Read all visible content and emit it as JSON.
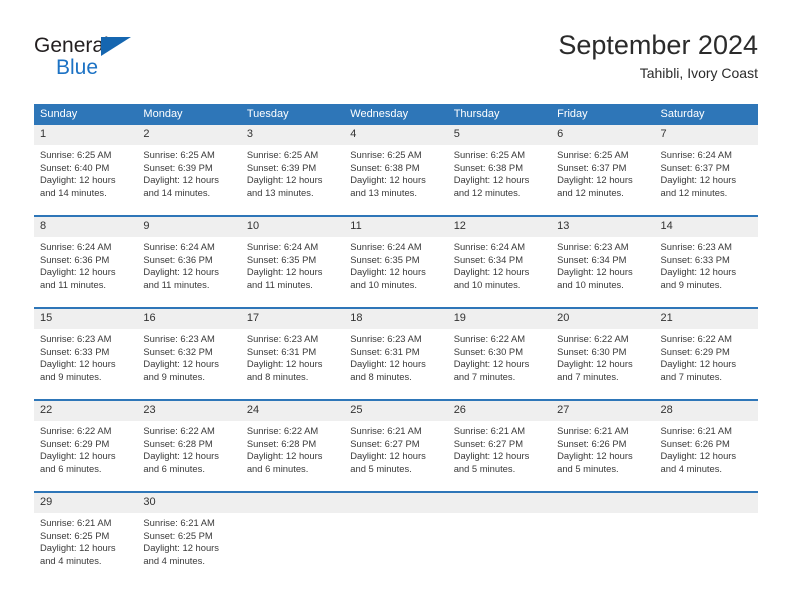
{
  "logo": {
    "word1": "General",
    "word2": "Blue",
    "triangle_color": "#1566b0",
    "word2_color": "#1c72c4"
  },
  "header": {
    "title": "September 2024",
    "subtitle": "Tahibli, Ivory Coast"
  },
  "calendar": {
    "header_bg": "#2e76b8",
    "daynum_bg": "#efefef",
    "weekdays": [
      "Sunday",
      "Monday",
      "Tuesday",
      "Wednesday",
      "Thursday",
      "Friday",
      "Saturday"
    ],
    "weeks": [
      [
        {
          "day": "1",
          "sunrise": "Sunrise: 6:25 AM",
          "sunset": "Sunset: 6:40 PM",
          "daylight1": "Daylight: 12 hours",
          "daylight2": "and 14 minutes."
        },
        {
          "day": "2",
          "sunrise": "Sunrise: 6:25 AM",
          "sunset": "Sunset: 6:39 PM",
          "daylight1": "Daylight: 12 hours",
          "daylight2": "and 14 minutes."
        },
        {
          "day": "3",
          "sunrise": "Sunrise: 6:25 AM",
          "sunset": "Sunset: 6:39 PM",
          "daylight1": "Daylight: 12 hours",
          "daylight2": "and 13 minutes."
        },
        {
          "day": "4",
          "sunrise": "Sunrise: 6:25 AM",
          "sunset": "Sunset: 6:38 PM",
          "daylight1": "Daylight: 12 hours",
          "daylight2": "and 13 minutes."
        },
        {
          "day": "5",
          "sunrise": "Sunrise: 6:25 AM",
          "sunset": "Sunset: 6:38 PM",
          "daylight1": "Daylight: 12 hours",
          "daylight2": "and 12 minutes."
        },
        {
          "day": "6",
          "sunrise": "Sunrise: 6:25 AM",
          "sunset": "Sunset: 6:37 PM",
          "daylight1": "Daylight: 12 hours",
          "daylight2": "and 12 minutes."
        },
        {
          "day": "7",
          "sunrise": "Sunrise: 6:24 AM",
          "sunset": "Sunset: 6:37 PM",
          "daylight1": "Daylight: 12 hours",
          "daylight2": "and 12 minutes."
        }
      ],
      [
        {
          "day": "8",
          "sunrise": "Sunrise: 6:24 AM",
          "sunset": "Sunset: 6:36 PM",
          "daylight1": "Daylight: 12 hours",
          "daylight2": "and 11 minutes."
        },
        {
          "day": "9",
          "sunrise": "Sunrise: 6:24 AM",
          "sunset": "Sunset: 6:36 PM",
          "daylight1": "Daylight: 12 hours",
          "daylight2": "and 11 minutes."
        },
        {
          "day": "10",
          "sunrise": "Sunrise: 6:24 AM",
          "sunset": "Sunset: 6:35 PM",
          "daylight1": "Daylight: 12 hours",
          "daylight2": "and 11 minutes."
        },
        {
          "day": "11",
          "sunrise": "Sunrise: 6:24 AM",
          "sunset": "Sunset: 6:35 PM",
          "daylight1": "Daylight: 12 hours",
          "daylight2": "and 10 minutes."
        },
        {
          "day": "12",
          "sunrise": "Sunrise: 6:24 AM",
          "sunset": "Sunset: 6:34 PM",
          "daylight1": "Daylight: 12 hours",
          "daylight2": "and 10 minutes."
        },
        {
          "day": "13",
          "sunrise": "Sunrise: 6:23 AM",
          "sunset": "Sunset: 6:34 PM",
          "daylight1": "Daylight: 12 hours",
          "daylight2": "and 10 minutes."
        },
        {
          "day": "14",
          "sunrise": "Sunrise: 6:23 AM",
          "sunset": "Sunset: 6:33 PM",
          "daylight1": "Daylight: 12 hours",
          "daylight2": "and 9 minutes."
        }
      ],
      [
        {
          "day": "15",
          "sunrise": "Sunrise: 6:23 AM",
          "sunset": "Sunset: 6:33 PM",
          "daylight1": "Daylight: 12 hours",
          "daylight2": "and 9 minutes."
        },
        {
          "day": "16",
          "sunrise": "Sunrise: 6:23 AM",
          "sunset": "Sunset: 6:32 PM",
          "daylight1": "Daylight: 12 hours",
          "daylight2": "and 9 minutes."
        },
        {
          "day": "17",
          "sunrise": "Sunrise: 6:23 AM",
          "sunset": "Sunset: 6:31 PM",
          "daylight1": "Daylight: 12 hours",
          "daylight2": "and 8 minutes."
        },
        {
          "day": "18",
          "sunrise": "Sunrise: 6:23 AM",
          "sunset": "Sunset: 6:31 PM",
          "daylight1": "Daylight: 12 hours",
          "daylight2": "and 8 minutes."
        },
        {
          "day": "19",
          "sunrise": "Sunrise: 6:22 AM",
          "sunset": "Sunset: 6:30 PM",
          "daylight1": "Daylight: 12 hours",
          "daylight2": "and 7 minutes."
        },
        {
          "day": "20",
          "sunrise": "Sunrise: 6:22 AM",
          "sunset": "Sunset: 6:30 PM",
          "daylight1": "Daylight: 12 hours",
          "daylight2": "and 7 minutes."
        },
        {
          "day": "21",
          "sunrise": "Sunrise: 6:22 AM",
          "sunset": "Sunset: 6:29 PM",
          "daylight1": "Daylight: 12 hours",
          "daylight2": "and 7 minutes."
        }
      ],
      [
        {
          "day": "22",
          "sunrise": "Sunrise: 6:22 AM",
          "sunset": "Sunset: 6:29 PM",
          "daylight1": "Daylight: 12 hours",
          "daylight2": "and 6 minutes."
        },
        {
          "day": "23",
          "sunrise": "Sunrise: 6:22 AM",
          "sunset": "Sunset: 6:28 PM",
          "daylight1": "Daylight: 12 hours",
          "daylight2": "and 6 minutes."
        },
        {
          "day": "24",
          "sunrise": "Sunrise: 6:22 AM",
          "sunset": "Sunset: 6:28 PM",
          "daylight1": "Daylight: 12 hours",
          "daylight2": "and 6 minutes."
        },
        {
          "day": "25",
          "sunrise": "Sunrise: 6:21 AM",
          "sunset": "Sunset: 6:27 PM",
          "daylight1": "Daylight: 12 hours",
          "daylight2": "and 5 minutes."
        },
        {
          "day": "26",
          "sunrise": "Sunrise: 6:21 AM",
          "sunset": "Sunset: 6:27 PM",
          "daylight1": "Daylight: 12 hours",
          "daylight2": "and 5 minutes."
        },
        {
          "day": "27",
          "sunrise": "Sunrise: 6:21 AM",
          "sunset": "Sunset: 6:26 PM",
          "daylight1": "Daylight: 12 hours",
          "daylight2": "and 5 minutes."
        },
        {
          "day": "28",
          "sunrise": "Sunrise: 6:21 AM",
          "sunset": "Sunset: 6:26 PM",
          "daylight1": "Daylight: 12 hours",
          "daylight2": "and 4 minutes."
        }
      ],
      [
        {
          "day": "29",
          "sunrise": "Sunrise: 6:21 AM",
          "sunset": "Sunset: 6:25 PM",
          "daylight1": "Daylight: 12 hours",
          "daylight2": "and 4 minutes."
        },
        {
          "day": "30",
          "sunrise": "Sunrise: 6:21 AM",
          "sunset": "Sunset: 6:25 PM",
          "daylight1": "Daylight: 12 hours",
          "daylight2": "and 4 minutes."
        },
        {
          "day": "",
          "sunrise": "",
          "sunset": "",
          "daylight1": "",
          "daylight2": ""
        },
        {
          "day": "",
          "sunrise": "",
          "sunset": "",
          "daylight1": "",
          "daylight2": ""
        },
        {
          "day": "",
          "sunrise": "",
          "sunset": "",
          "daylight1": "",
          "daylight2": ""
        },
        {
          "day": "",
          "sunrise": "",
          "sunset": "",
          "daylight1": "",
          "daylight2": ""
        },
        {
          "day": "",
          "sunrise": "",
          "sunset": "",
          "daylight1": "",
          "daylight2": ""
        }
      ]
    ]
  }
}
